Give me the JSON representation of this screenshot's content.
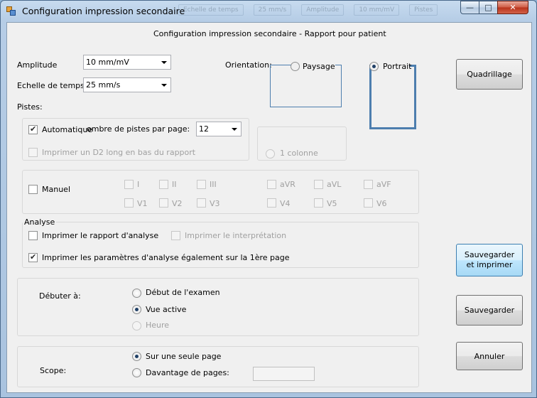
{
  "window": {
    "title": "Configuration impression secondaire",
    "background_tabs": [
      "Echelle de temps",
      "25 mm/s",
      "Amplitude",
      "10 mm/mV",
      "Pistes"
    ],
    "minimize_glyph": "—",
    "maximize_glyph": "□",
    "close_glyph": "✕"
  },
  "header": {
    "title": "Configuration impression secondaire - Rapport pour patient"
  },
  "amplitude": {
    "label": "Amplitude",
    "value": "10 mm/mV"
  },
  "time_scale": {
    "label": "Echelle de temps",
    "value": "25 mm/s"
  },
  "orientation": {
    "label": "Orientation:",
    "landscape": {
      "label": "Paysage",
      "selected": false
    },
    "portrait": {
      "label": "Portrait",
      "selected": true
    }
  },
  "tracks": {
    "label": "Pistes:",
    "automatic": {
      "label": "Automatique",
      "checked": true
    },
    "count_label": "ombre de pistes par page:",
    "count_value": "12",
    "long_d2": {
      "label": "Imprimer un D2 long en bas du rapport",
      "checked": false,
      "enabled": false
    },
    "one_column": {
      "label": "1 colonne",
      "enabled": false
    }
  },
  "manual": {
    "label": "Manuel",
    "checked": false,
    "leads_row1": [
      "I",
      "II",
      "III",
      "aVR",
      "aVL",
      "aVF"
    ],
    "leads_row2": [
      "V1",
      "V2",
      "V3",
      "V4",
      "V5",
      "V6"
    ]
  },
  "analysis": {
    "legend": "Analyse",
    "print_report": {
      "label": "Imprimer le rapport d'analyse",
      "checked": false
    },
    "print_interpretation": {
      "label": "Imprimer le interprétation",
      "checked": false,
      "enabled": false
    },
    "print_params": {
      "label": "Imprimer les paramètres d'analyse également sur la 1ère page",
      "checked": true
    }
  },
  "start_at": {
    "label": "Débuter à:",
    "options": [
      {
        "label": "Début de l'examen",
        "selected": false,
        "enabled": true
      },
      {
        "label": "Vue active",
        "selected": true,
        "enabled": true
      },
      {
        "label": "Heure",
        "selected": false,
        "enabled": false
      }
    ]
  },
  "scope": {
    "label": "Scope:",
    "single_page": {
      "label": "Sur une seule page",
      "selected": true
    },
    "more_pages": {
      "label": "Davantage de pages:",
      "selected": false,
      "value": ""
    }
  },
  "buttons": {
    "grid": "Quadrillage",
    "save_print": "Sauvegarder et imprimer",
    "save": "Sauvegarder",
    "cancel": "Annuler"
  }
}
